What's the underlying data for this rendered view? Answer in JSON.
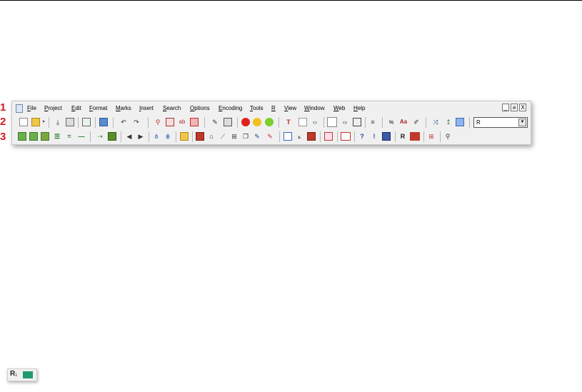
{
  "callouts": [
    "1",
    "2",
    "3"
  ],
  "menu": {
    "items": [
      "File",
      "Project",
      "Edit",
      "Format",
      "Marks",
      "Insert",
      "Search",
      "Options",
      "Encoding",
      "Tools",
      "R",
      "View",
      "Window",
      "Web",
      "Help"
    ],
    "window_controls": [
      "_",
      "ə",
      "X"
    ]
  },
  "toolbar2": {
    "icons": [
      "new-file-icon",
      "open-file-icon",
      "dropdown-arrow-icon",
      "download-icon",
      "save-all-icon",
      "reload-icon",
      "print-icon",
      "undo-icon",
      "redo-icon",
      "find-icon",
      "find-in-files-icon",
      "replace-icon",
      "delete-icon",
      "attach-icon",
      "spell-icon",
      "red-circle-icon",
      "yellow-circle-icon",
      "green-circle-icon",
      "column-icon",
      "split-icon",
      "code-icon",
      "panel-icon",
      "html-icon",
      "edit-icon",
      "wrap-icon",
      "sort-icon",
      "font-icon",
      "highlight-icon",
      "shuffle-icon",
      "up-icon",
      "monitor-icon"
    ],
    "select_value": "R"
  },
  "toolbar3": {
    "icons": [
      "doc-green-icon",
      "doc-arrow-icon",
      "paste-icon",
      "list-icon",
      "equal-icon",
      "dash-icon",
      "indent-icon",
      "block-icon",
      "prev-icon",
      "next-icon",
      "tree-icon",
      "tree2-icon",
      "folder-icon",
      "chart-icon",
      "tent-icon",
      "line-chart-icon",
      "boxplot-icon",
      "cube-icon",
      "pen-icon",
      "pen2-icon",
      "window-icon",
      "plot-icon",
      "x-mark-icon",
      "red-box-icon",
      "text-box-icon",
      "help-icon",
      "alert-icon",
      "rd-icon",
      "r-send-icon",
      "red-square-icon",
      "gift-icon",
      "magnify-icon"
    ]
  },
  "mini": {
    "letter": "R",
    "subscript": "1"
  },
  "colors": {
    "accent": "#d21b1b",
    "toolbar_bg": "#f0f0f0",
    "green_block": "#1f9a6c"
  }
}
